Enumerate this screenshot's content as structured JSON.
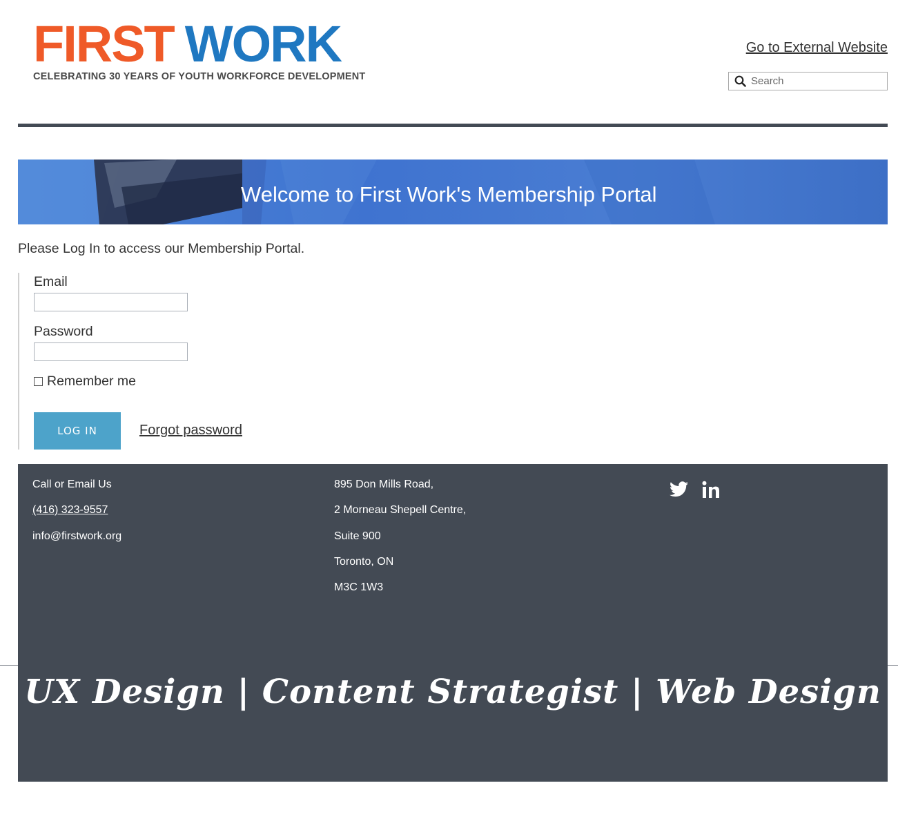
{
  "header": {
    "logo_first": "FIRST",
    "logo_work": "WORK",
    "tagline": "CELEBRATING 30 YEARS OF YOUTH WORKFORCE DEVELOPMENT",
    "external_link": "Go to External Website",
    "search_placeholder": "Search"
  },
  "banner": {
    "title": "Welcome to First Work's Membership Portal"
  },
  "login": {
    "intro": "Please Log In to access our Membership Portal.",
    "email_label": "Email",
    "email_value": "",
    "password_label": "Password",
    "password_value": "",
    "remember_label": "Remember me",
    "remember_checked": false,
    "login_button": "LOG IN",
    "forgot_link": "Forgot password"
  },
  "footer": {
    "contact_heading": "Call or Email Us",
    "phone": "(416) 323-9557",
    "email": "info@firstwork.org",
    "address": [
      "895 Don Mills Road,",
      "2 Morneau Shepell Centre,",
      "Suite 900",
      "Toronto, ON",
      "M3C 1W3"
    ],
    "social_icons": [
      "twitter-icon",
      "linkedin-icon"
    ],
    "brand_line": "UX Design | Content Strategist | Web Design"
  },
  "colors": {
    "first_orange": "#ef5a28",
    "work_blue": "#1f78c1",
    "banner_blue": "#4478d0",
    "button_blue": "#4da3ca",
    "footer_dark": "#434a54"
  }
}
